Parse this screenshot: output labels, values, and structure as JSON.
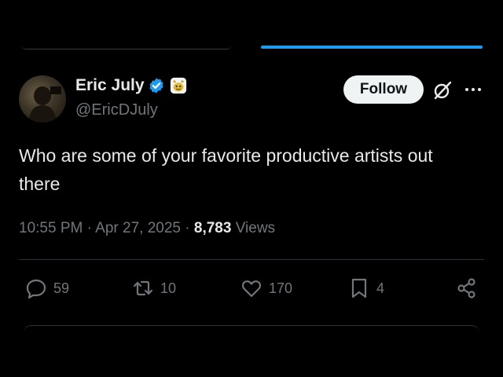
{
  "author": {
    "name": "Eric July",
    "handle": "@EricDJuly",
    "verified_color": "#1d9bf0"
  },
  "follow_label": "Follow",
  "tweet": {
    "text": "Who are some of your favorite productive artists out there"
  },
  "meta": {
    "time": "10:55 PM",
    "sep1": " · ",
    "date": "Apr 27, 2025",
    "sep2": " · ",
    "views_count": "8,783",
    "views_label": " Views"
  },
  "actions": {
    "replies": "59",
    "reposts": "10",
    "likes": "170",
    "bookmarks": "4"
  },
  "colors": {
    "background": "#000000",
    "accent": "#1d9bf0",
    "muted": "#71767b",
    "text": "#e7e9ea"
  },
  "icons": [
    "verified-icon",
    "affiliate-badge-icon",
    "grok-icon",
    "more-icon",
    "reply-icon",
    "repost-icon",
    "like-icon",
    "bookmark-icon",
    "share-icon"
  ]
}
